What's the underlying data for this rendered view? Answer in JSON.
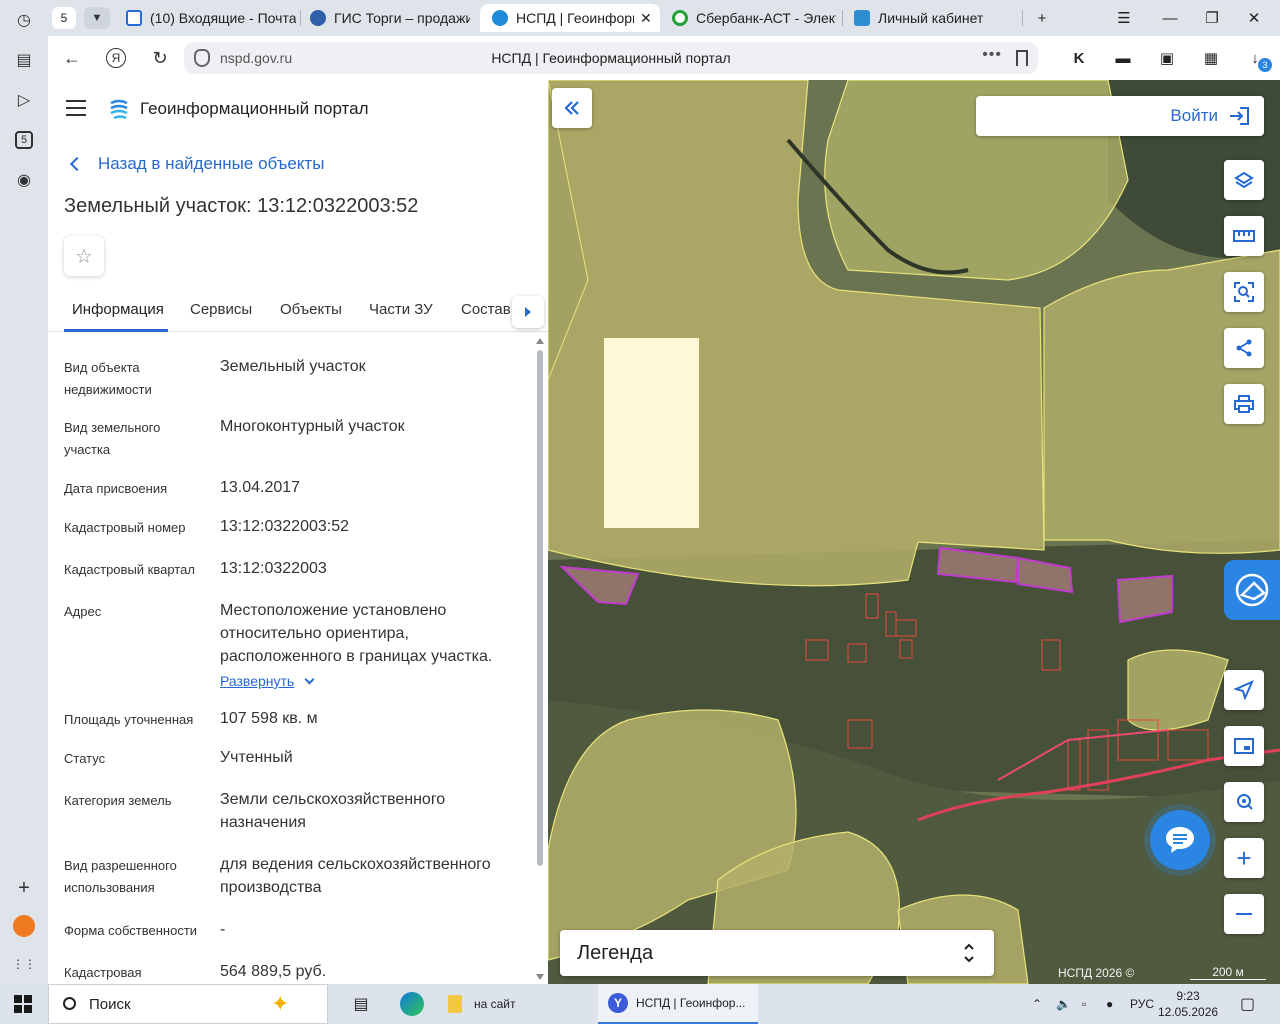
{
  "browser": {
    "tab_count": "5",
    "tabs": [
      {
        "title": "(10) Входящие - Почта",
        "color": "#2a6ad8"
      },
      {
        "title": "ГИС Торги – продажи",
        "color": "#2f5fa8"
      },
      {
        "title": "НСПД | Геоинформ",
        "color": "#1f8ad8",
        "active": true
      },
      {
        "title": "Сбербанк-АСТ - Элект",
        "color": "#21a038"
      },
      {
        "title": "Личный кабинет",
        "color": "#2d8fd1"
      }
    ],
    "url_host": "nspd.gov.ru",
    "page_title": "НСПД | Геоинформационный портал",
    "download_badge": "3"
  },
  "sidebar": {
    "counter": "5"
  },
  "panel": {
    "app_title": "Геоинформационный портал",
    "back_label": "Назад в найденные объекты",
    "object_title": "Земельный участок: 13:12:0322003:52",
    "tabs": [
      "Информация",
      "Сервисы",
      "Объекты",
      "Части ЗУ",
      "Состав"
    ],
    "properties": [
      {
        "label": "Вид объекта недвижимости",
        "value": "Земельный участок"
      },
      {
        "label": "Вид земельного участка",
        "value": "Многоконтурный участок"
      },
      {
        "label": "Дата присвоения",
        "value": "13.04.2017"
      },
      {
        "label": "Кадастровый номер",
        "value": "13:12:0322003:52"
      },
      {
        "label": "Кадастровый квартал",
        "value": "13:12:0322003"
      },
      {
        "label": "Адрес",
        "value": "Местоположение установлено относительно ориентира, расположенного в границах участка."
      },
      {
        "label": "Площадь уточненная",
        "value": "107 598 кв. м"
      },
      {
        "label": "Статус",
        "value": "Учтенный"
      },
      {
        "label": "Категория земель",
        "value": "Земли сельскохозяйственного назначения"
      },
      {
        "label": "Вид разрешенного использования",
        "value": "для ведения сельскохозяйственного производства"
      },
      {
        "label": "Форма собственности",
        "value": "-"
      },
      {
        "label": "Кадастровая",
        "value": "564 889,5 руб."
      }
    ],
    "expand_label": "Развернуть"
  },
  "map": {
    "login_label": "Войти",
    "legend_label": "Легенда",
    "attribution": "НСПД 2026 ©",
    "scale_label": "200 м"
  },
  "taskbar": {
    "search_label": "Поиск",
    "apps": [
      {
        "label": "на сайт"
      },
      {
        "label": "НСПД | Геоинфор..."
      }
    ],
    "language": "РУС",
    "time": "9:23",
    "date": "12.05.2026"
  }
}
